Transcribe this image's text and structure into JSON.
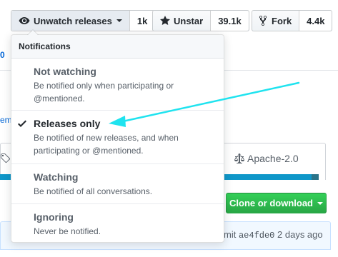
{
  "header": {
    "watch": {
      "label": "Unwatch releases",
      "count": "1k",
      "icon": "eye-icon"
    },
    "star": {
      "label": "Unstar",
      "count": "39.1k",
      "icon": "star-icon"
    },
    "fork": {
      "label": "Fork",
      "count": "4.4k",
      "icon": "repo-forked-icon"
    }
  },
  "background": {
    "edge_count": "0",
    "edge_link": "em",
    "license": {
      "label": "Apache-2.0",
      "icon": "law-icon"
    },
    "clone_button": "Clone or download",
    "commit": {
      "prefix": "mit",
      "sha": "ae4fde0",
      "time": "2 days ago"
    }
  },
  "dropdown": {
    "header": "Notifications",
    "items": [
      {
        "title": "Not watching",
        "description": "Be notified only when participating or @mentioned.",
        "selected": false
      },
      {
        "title": "Releases only",
        "description": "Be notified of new releases, and when participating or @mentioned.",
        "selected": true
      },
      {
        "title": "Watching",
        "description": "Be notified of all conversations.",
        "selected": false
      },
      {
        "title": "Ignoring",
        "description": "Never be notified.",
        "selected": false
      }
    ]
  },
  "colors": {
    "annotation_arrow": "#1fe3ef",
    "primary_green": "#28a745",
    "language_bar": "#0f97c9",
    "link_blue": "#0366d6"
  }
}
